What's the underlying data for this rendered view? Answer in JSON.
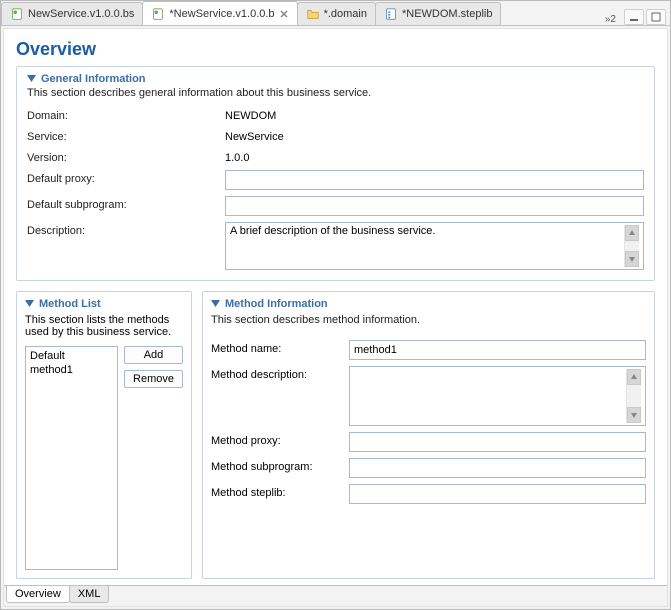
{
  "tabs": [
    {
      "label": "NewService.v1.0.0.bs",
      "icon": "doc-green",
      "closeable": false,
      "active": false
    },
    {
      "label": "*NewService.v1.0.0.b",
      "icon": "doc-green",
      "closeable": true,
      "active": true
    },
    {
      "label": "*.domain",
      "icon": "folder",
      "closeable": false,
      "active": false
    },
    {
      "label": "*NEWDOM.steplib",
      "icon": "steplib",
      "closeable": false,
      "active": false
    }
  ],
  "tabbar_overflow": "»2",
  "page_title": "Overview",
  "general": {
    "title": "General Information",
    "desc": "This section describes general information about this business service.",
    "domain_label": "Domain:",
    "domain_value": "NEWDOM",
    "service_label": "Service:",
    "service_value": "NewService",
    "version_label": "Version:",
    "version_value": "1.0.0",
    "default_proxy_label": "Default proxy:",
    "default_proxy_value": "",
    "default_subprogram_label": "Default subprogram:",
    "default_subprogram_value": "",
    "description_label": "Description:",
    "description_value": "A brief description of the business service."
  },
  "methodList": {
    "title": "Method List",
    "desc": "This section lists the methods used by this business service.",
    "items": [
      "Default",
      "method1"
    ],
    "add_label": "Add",
    "remove_label": "Remove"
  },
  "methodInfo": {
    "title": "Method Information",
    "desc": "This section describes method information.",
    "name_label": "Method name:",
    "name_value": "method1",
    "desc_label": "Method description:",
    "desc_value": "",
    "proxy_label": "Method proxy:",
    "proxy_value": "",
    "subprogram_label": "Method subprogram:",
    "subprogram_value": "",
    "steplib_label": "Method steplib:",
    "steplib_value": ""
  },
  "pageTabs": {
    "overview": "Overview",
    "xml": "XML"
  }
}
